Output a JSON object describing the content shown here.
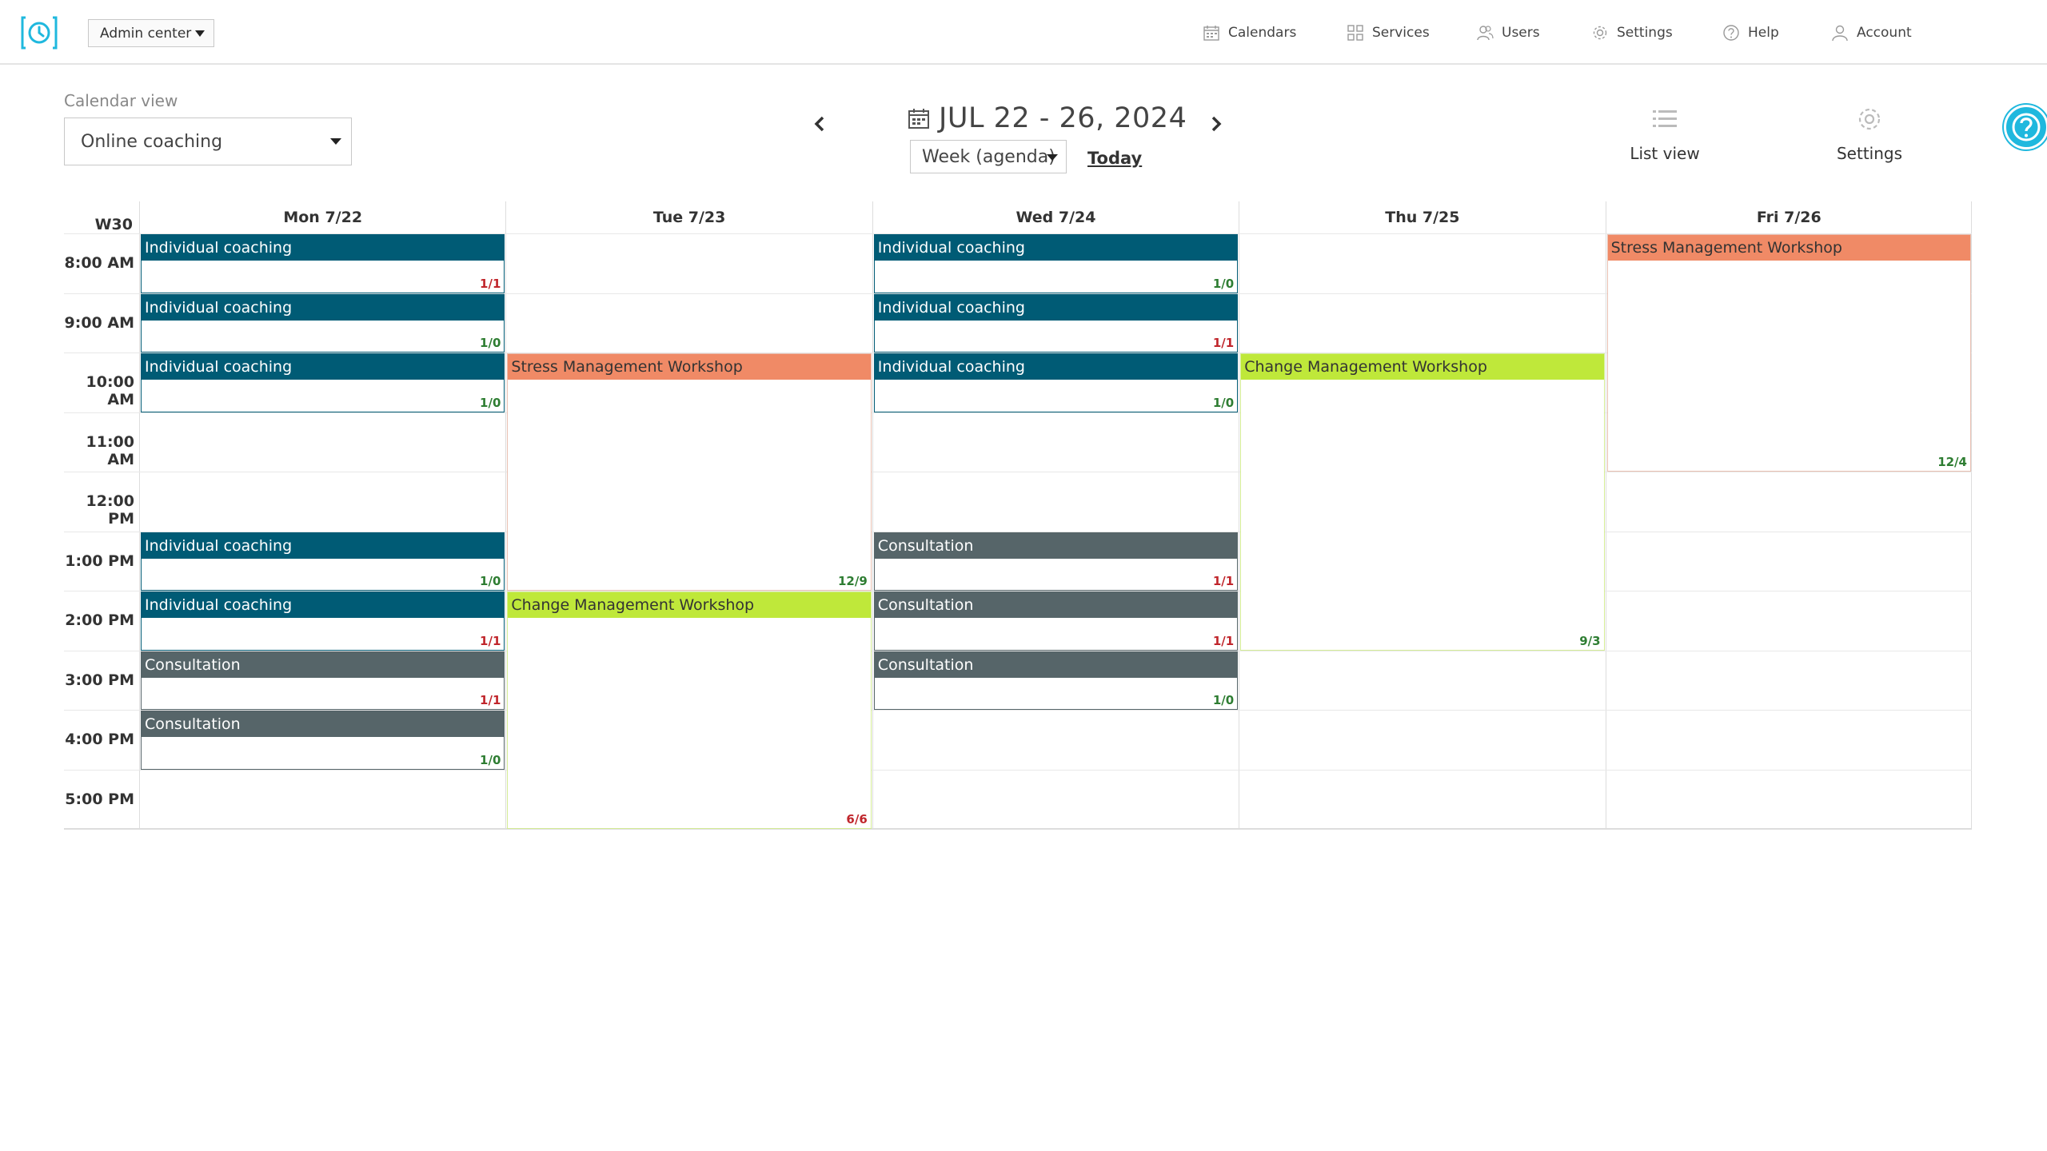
{
  "nav": {
    "admin_center": "Admin center",
    "items": [
      {
        "label": "Calendars",
        "icon": "calendar-icon"
      },
      {
        "label": "Services",
        "icon": "grid-icon"
      },
      {
        "label": "Users",
        "icon": "users-icon"
      },
      {
        "label": "Settings",
        "icon": "gear-icon"
      },
      {
        "label": "Help",
        "icon": "help-icon"
      },
      {
        "label": "Account",
        "icon": "account-icon"
      }
    ]
  },
  "controls": {
    "calendar_view_label": "Calendar view",
    "calendar_view_value": "Online coaching",
    "date_range": "JUL 22 - 26, 2024",
    "week_mode": "Week (agenda)",
    "today": "Today",
    "list_view": "List view",
    "settings": "Settings"
  },
  "calendar": {
    "week_label": "W30",
    "days": [
      "Mon 7/22",
      "Tue 7/23",
      "Wed 7/24",
      "Thu 7/25",
      "Fri 7/26"
    ],
    "hours": [
      "8:00 AM",
      "9:00 AM",
      "10:00 AM",
      "11:00 AM",
      "12:00 PM",
      "1:00 PM",
      "2:00 PM",
      "3:00 PM",
      "4:00 PM",
      "5:00 PM"
    ],
    "events": [
      {
        "day": 0,
        "start": 8,
        "end": 9,
        "title": "Individual coaching",
        "count": "1/1",
        "type": "coaching",
        "full": true
      },
      {
        "day": 0,
        "start": 9,
        "end": 10,
        "title": "Individual coaching",
        "count": "1/0",
        "type": "coaching",
        "full": false
      },
      {
        "day": 0,
        "start": 10,
        "end": 11,
        "title": "Individual coaching",
        "count": "1/0",
        "type": "coaching",
        "full": false
      },
      {
        "day": 0,
        "start": 13,
        "end": 14,
        "title": "Individual coaching",
        "count": "1/0",
        "type": "coaching",
        "full": false
      },
      {
        "day": 0,
        "start": 14,
        "end": 15,
        "title": "Individual coaching",
        "count": "1/1",
        "type": "coaching",
        "full": true
      },
      {
        "day": 0,
        "start": 15,
        "end": 16,
        "title": "Consultation",
        "count": "1/1",
        "type": "consultation",
        "full": true
      },
      {
        "day": 0,
        "start": 16,
        "end": 17,
        "title": "Consultation",
        "count": "1/0",
        "type": "consultation",
        "full": false
      },
      {
        "day": 1,
        "start": 10,
        "end": 14,
        "title": "Stress Management Workshop",
        "count": "12/9",
        "type": "stress",
        "full": false
      },
      {
        "day": 1,
        "start": 14,
        "end": 18,
        "title": "Change Management Workshop",
        "count": "6/6",
        "type": "change",
        "full": true
      },
      {
        "day": 2,
        "start": 8,
        "end": 9,
        "title": "Individual coaching",
        "count": "1/0",
        "type": "coaching",
        "full": false
      },
      {
        "day": 2,
        "start": 9,
        "end": 10,
        "title": "Individual coaching",
        "count": "1/1",
        "type": "coaching",
        "full": true
      },
      {
        "day": 2,
        "start": 10,
        "end": 11,
        "title": "Individual coaching",
        "count": "1/0",
        "type": "coaching",
        "full": false
      },
      {
        "day": 2,
        "start": 13,
        "end": 14,
        "title": "Consultation",
        "count": "1/1",
        "type": "consultation",
        "full": true
      },
      {
        "day": 2,
        "start": 14,
        "end": 15,
        "title": "Consultation",
        "count": "1/1",
        "type": "consultation",
        "full": true
      },
      {
        "day": 2,
        "start": 15,
        "end": 16,
        "title": "Consultation",
        "count": "1/0",
        "type": "consultation",
        "full": false
      },
      {
        "day": 3,
        "start": 10,
        "end": 15,
        "title": "Change Management Workshop",
        "count": "9/3",
        "type": "change",
        "full": false
      },
      {
        "day": 4,
        "start": 8,
        "end": 12,
        "title": "Stress Management Workshop",
        "count": "12/4",
        "type": "stress",
        "full": false
      }
    ]
  },
  "colors": {
    "coaching": {
      "head": "#005b75",
      "text": "#ffffff",
      "border": "#005b75"
    },
    "consultation": {
      "head": "#566569",
      "text": "#ffffff",
      "border": "#566569"
    },
    "stress": {
      "head": "#f08a66",
      "text": "#333333",
      "border": "#e9c0b2"
    },
    "change": {
      "head": "#bfe83a",
      "text": "#333333",
      "border": "#d4ec95"
    },
    "count_full": "#c0262c",
    "count_open": "#2e7d32",
    "accent": "#1fb8de"
  }
}
